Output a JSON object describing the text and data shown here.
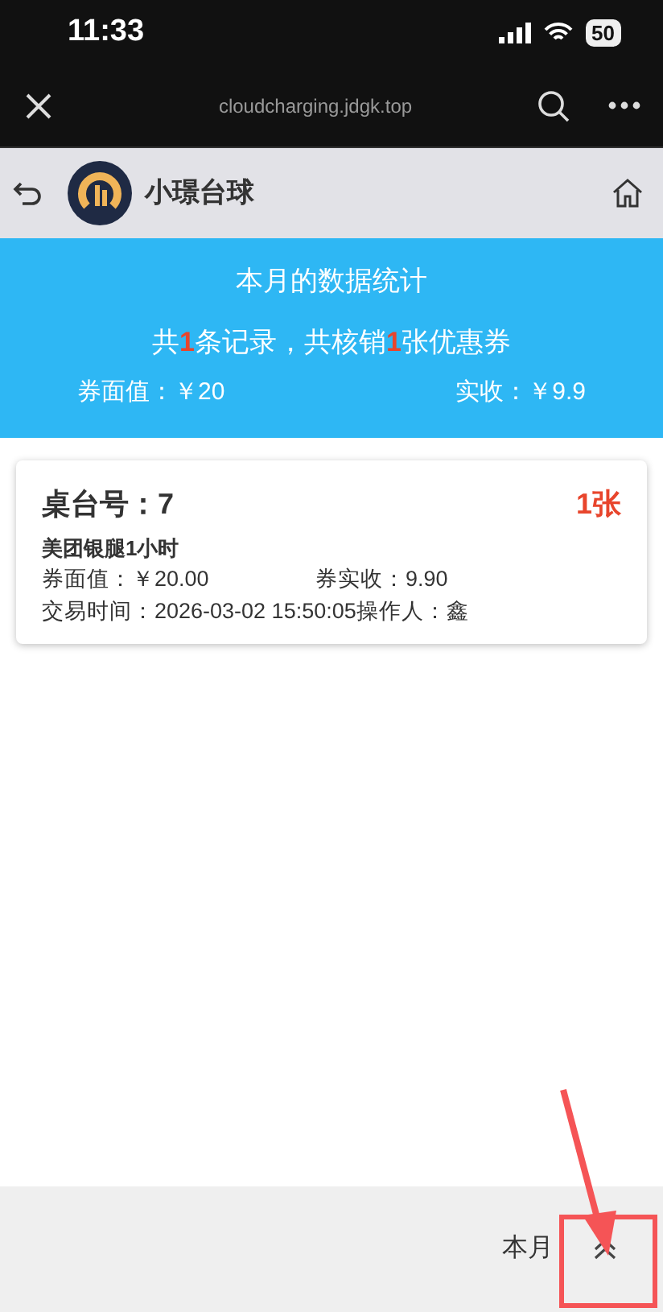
{
  "status_bar": {
    "time": "11:33",
    "battery": "50"
  },
  "browser_bar": {
    "url": "cloudcharging.jdgk.top"
  },
  "header": {
    "title": "小璟台球"
  },
  "summary": {
    "title": "本月的数据统计",
    "line": "共**1**条记录，共核销**1**张优惠券",
    "face_value": "券面值：￥20",
    "received": "实收：￥9.9"
  },
  "records": [
    {
      "table": "桌台号：7",
      "count": "1张",
      "coupon": "美团银腿1小时",
      "face_value": "券面值：￥20.00",
      "received": "券实收：9.90",
      "time": "交易时间：2026-03-02 15:50:05操作人：鑫"
    }
  ],
  "bottom_bar": {
    "period": "本月"
  }
}
